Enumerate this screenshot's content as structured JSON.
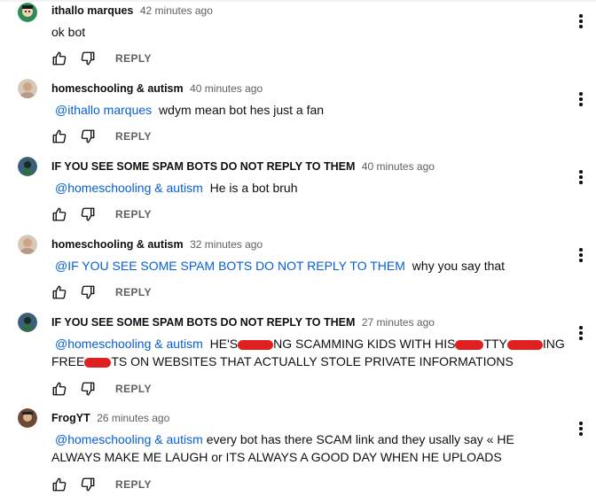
{
  "reply_label": "REPLY",
  "icons": {
    "like": "thumb-up-outline-icon",
    "dislike": "thumb-down-outline-icon",
    "menu": "more-vertical-icon"
  },
  "colors": {
    "mention": "#065fd4",
    "secondary": "#606060",
    "redaction": "#e02020"
  },
  "comments": [
    {
      "author": "ithallo marques",
      "time": "42 minutes ago",
      "mention": "",
      "text": "ok bot"
    },
    {
      "author": "homeschooling & autism",
      "time": "40 minutes ago",
      "mention": "@ithallo marques",
      "text": " wdym mean bot hes just a fan"
    },
    {
      "author": "IF YOU SEE SOME SPAM BOTS DO NOT REPLY TO THEM",
      "time": "40 minutes ago",
      "mention": "@homeschooling & autism",
      "text": " He is a bot bruh"
    },
    {
      "author": "homeschooling & autism",
      "time": "32 minutes ago",
      "mention": "@IF YOU SEE SOME SPAM BOTS DO NOT REPLY TO THEM",
      "text": " why you say that"
    },
    {
      "author": "IF YOU SEE SOME SPAM BOTS DO NOT REPLY TO THEM",
      "time": "27 minutes ago",
      "mention": "@homeschooling & autism",
      "text_parts": [
        "HE'S",
        "NG SCAMMING KIDS WITH HIS",
        "TTY",
        "ING FREE",
        "TS ON WEBSITES THAT ACTUALLY STOLE PRIVATE INFORMATIONS"
      ]
    },
    {
      "author": "FrogYT",
      "time": "26 minutes ago",
      "mention": "@homeschooling & autism",
      "text": "every bot has there SCAM link and they usally say « HE ALWAYS MAKE ME LAUGH or ITS ALWAYS A GOOD DAY WHEN HE UPLOADS"
    }
  ]
}
